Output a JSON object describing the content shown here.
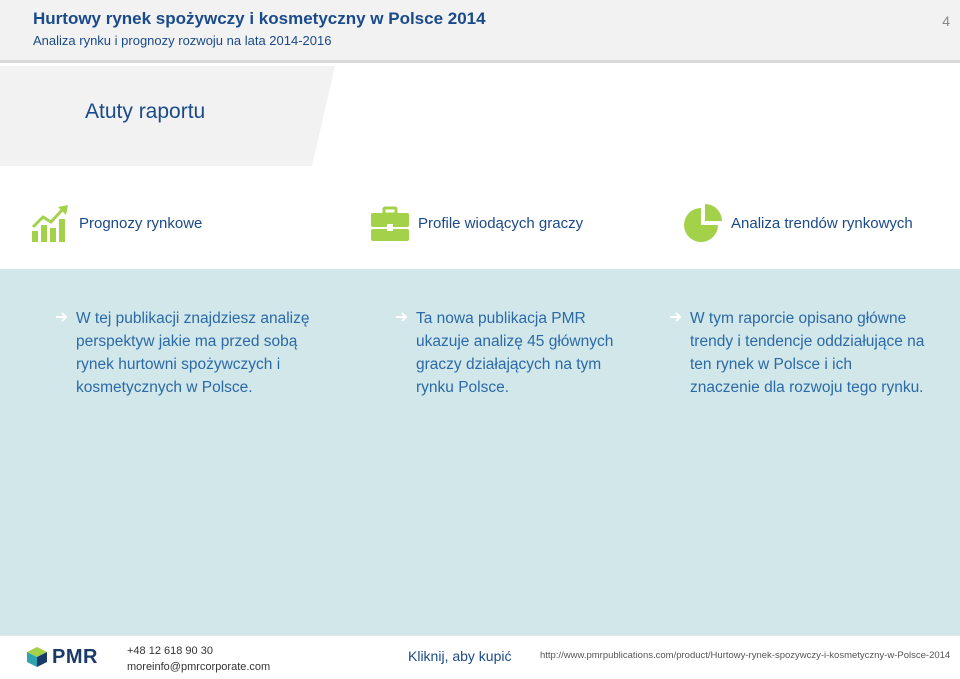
{
  "header": {
    "title": "Hurtowy rynek spożywczy i kosmetyczny w Polsce 2014",
    "subtitle": "Analiza rynku i prognozy rozwoju na lata 2014-2016",
    "page_number": "4"
  },
  "section": {
    "title": "Atuty raportu"
  },
  "features": [
    {
      "label": "Prognozy rynkowe",
      "icon": "chart-growth-icon"
    },
    {
      "label": "Profile wiodących graczy",
      "icon": "briefcase-icon"
    },
    {
      "label": "Analiza trendów rynkowych",
      "icon": "pie-chart-icon"
    }
  ],
  "columns": [
    {
      "lines": [
        "W tej publikacji znajdziesz analizę",
        "perspektyw jakie ma przed sobą",
        "rynek hurtowni spożywczych i",
        "kosmetycznych w Polsce."
      ]
    },
    {
      "lines": [
        "Ta nowa publikacja PMR",
        "ukazuje analizę 45 głównych",
        "graczy działających na  tym",
        "rynku Polsce."
      ]
    },
    {
      "lines": [
        "W tym raporcie opisano główne",
        "trendy i tendencje oddziałujące na",
        "ten rynek w Polsce i ich",
        "znaczenie dla rozwoju tego rynku."
      ]
    }
  ],
  "footer": {
    "logo_text": "PMR",
    "phone": "+48 12 618 90 30",
    "email": "moreinfo@pmrcorporate.com",
    "cta": "Kliknij, aby kupić",
    "url": "http://www.pmrpublications.com/product/Hurtowy-rynek-spozywczy-i-kosmetyczny-w-Polsce-2014"
  },
  "colors": {
    "accent_green": "#a3d14a",
    "title_blue": "#1a4a8a",
    "content_bg": "#d1e7ea"
  }
}
